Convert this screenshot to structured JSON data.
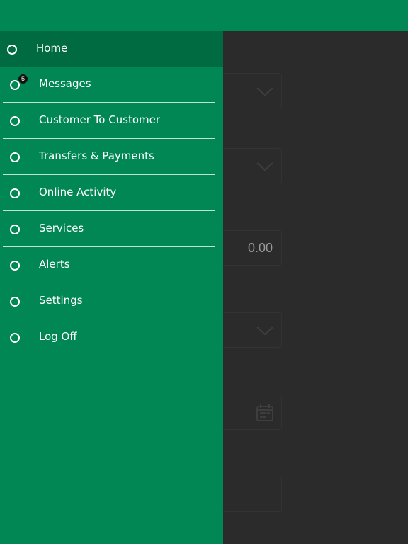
{
  "colors": {
    "brand_green": "#008753",
    "active_green": "#006b41",
    "overlay_dark": "#2b2b2b"
  },
  "menu": {
    "items": [
      {
        "label": "Home",
        "icon": "circle-icon",
        "active": true
      },
      {
        "label": "Messages",
        "icon": "circle-icon",
        "badge": "5"
      },
      {
        "label": "Customer To Customer",
        "icon": "circle-icon"
      },
      {
        "label": "Transfers & Payments",
        "icon": "circle-icon"
      },
      {
        "label": "Online Activity",
        "icon": "circle-icon"
      },
      {
        "label": "Services",
        "icon": "circle-icon"
      },
      {
        "label": "Alerts",
        "icon": "circle-icon"
      },
      {
        "label": "Settings",
        "icon": "circle-icon"
      },
      {
        "label": "Log Off",
        "icon": "circle-icon"
      }
    ]
  },
  "background_form": {
    "amount_value": "0.00",
    "icons": [
      "chevron-down-icon",
      "chevron-down-icon",
      "chevron-down-icon",
      "calendar-icon"
    ]
  }
}
